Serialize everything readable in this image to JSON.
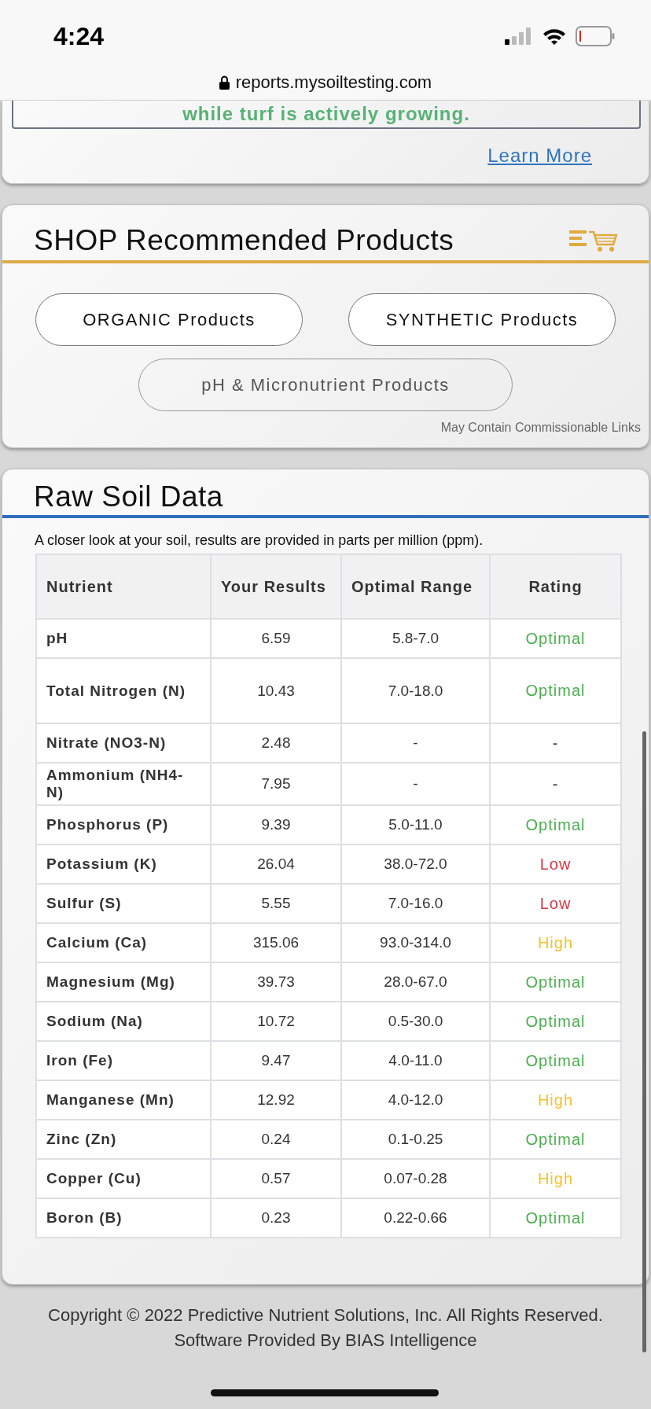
{
  "status_bar": {
    "time": "4:24",
    "url": "reports.mysoiltesting.com"
  },
  "tip_card": {
    "tip_text": "while turf is actively growing.",
    "link": "Learn More"
  },
  "shop": {
    "title": "SHOP Recommended Products",
    "buttons": [
      {
        "label": "ORGANIC Products",
        "kind": "primary"
      },
      {
        "label": "SYNTHETIC Products",
        "kind": "primary"
      },
      {
        "label": "pH & Micronutrient Products",
        "kind": "secondary"
      }
    ],
    "disclaimer": "May Contain Commissionable Links"
  },
  "raw_soil": {
    "title": "Raw Soil Data",
    "subtitle": "A closer look at your soil, results are provided in parts per million (ppm).",
    "table": {
      "columns": [
        "Nutrient",
        "Your Results",
        "Optimal Range",
        "Rating"
      ],
      "rows": [
        {
          "nutrient": "pH",
          "result": "6.59",
          "range": "5.8-7.0",
          "rating": "Optimal",
          "color": "#4caf50"
        },
        {
          "nutrient": "Total Nitrogen (N)",
          "result": "10.43",
          "range": "7.0-18.0",
          "rating": "Optimal",
          "color": "#4caf50"
        },
        {
          "nutrient": "Nitrate (NO3-N)",
          "result": "2.48",
          "range": "-",
          "rating": "-",
          "color": "#333333"
        },
        {
          "nutrient": "Ammonium (NH4-N)",
          "result": "7.95",
          "range": "-",
          "rating": "-",
          "color": "#333333"
        },
        {
          "nutrient": "Phosphorus (P)",
          "result": "9.39",
          "range": "5.0-11.0",
          "rating": "Optimal",
          "color": "#4caf50"
        },
        {
          "nutrient": "Potassium (K)",
          "result": "26.04",
          "range": "38.0-72.0",
          "rating": "Low",
          "color": "#dc3545"
        },
        {
          "nutrient": "Sulfur (S)",
          "result": "5.55",
          "range": "7.0-16.0",
          "rating": "Low",
          "color": "#dc3545"
        },
        {
          "nutrient": "Calcium (Ca)",
          "result": "315.06",
          "range": "93.0-314.0",
          "rating": "High",
          "color": "#f5c12e"
        },
        {
          "nutrient": "Magnesium (Mg)",
          "result": "39.73",
          "range": "28.0-67.0",
          "rating": "Optimal",
          "color": "#4caf50"
        },
        {
          "nutrient": "Sodium (Na)",
          "result": "10.72",
          "range": "0.5-30.0",
          "rating": "Optimal",
          "color": "#4caf50"
        },
        {
          "nutrient": "Iron (Fe)",
          "result": "9.47",
          "range": "4.0-11.0",
          "rating": "Optimal",
          "color": "#4caf50"
        },
        {
          "nutrient": "Manganese (Mn)",
          "result": "12.92",
          "range": "4.0-12.0",
          "rating": "High",
          "color": "#f5c12e"
        },
        {
          "nutrient": "Zinc (Zn)",
          "result": "0.24",
          "range": "0.1-0.25",
          "rating": "Optimal",
          "color": "#4caf50"
        },
        {
          "nutrient": "Copper (Cu)",
          "result": "0.57",
          "range": "0.07-0.28",
          "rating": "High",
          "color": "#f5c12e"
        },
        {
          "nutrient": "Boron (B)",
          "result": "0.23",
          "range": "0.22-0.66",
          "rating": "Optimal",
          "color": "#4caf50"
        }
      ]
    }
  },
  "footer": {
    "lines": [
      "Copyright © 2022 Predictive Nutrient Solutions, Inc. All Rights Reserved.",
      "Software Provided By BIAS Intelligence"
    ]
  }
}
